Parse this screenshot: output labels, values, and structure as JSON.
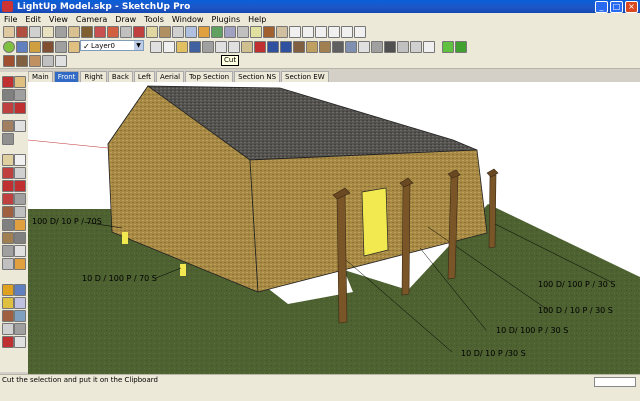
{
  "window": {
    "title": "LightUp Model.skp - SketchUp Pro",
    "minimize_glyph": "_",
    "maximize_glyph": "□",
    "close_glyph": "×"
  },
  "menu": [
    "File",
    "Edit",
    "View",
    "Camera",
    "Draw",
    "Tools",
    "Window",
    "Plugins",
    "Help"
  ],
  "toolbar": {
    "layer_select": {
      "value": "Layer0",
      "check": "✓",
      "arrow": "▼"
    },
    "tooltip": "Cut"
  },
  "scene_tabs": [
    {
      "label": "Main",
      "active": false
    },
    {
      "label": "Front",
      "active": true
    },
    {
      "label": "Right",
      "active": false
    },
    {
      "label": "Back",
      "active": false
    },
    {
      "label": "Left",
      "active": false
    },
    {
      "label": "Aerial",
      "active": false
    },
    {
      "label": "Top Section",
      "active": false
    },
    {
      "label": "Section NS",
      "active": false
    },
    {
      "label": "Section EW",
      "active": false
    }
  ],
  "viewport": {
    "dimension_labels": [
      "100 D/ 10 P / 70S",
      "10 D / 100 P / 70 S",
      "100 D/ 100 P / 30 S",
      "100 D / 10 P / 30 S",
      "10 D/ 100 P / 30 S",
      "10 D/ 10 P /30 S"
    ]
  },
  "status": {
    "text": "Cut the selection and put it on the Clipboard"
  },
  "colors": {
    "wall": "#a88a45",
    "roof": "#55534f",
    "ground": "#4d6131",
    "sky": "#ffffff",
    "post": "#7a5527",
    "door": "#f1e94f",
    "title_bar": "#1e56c6"
  }
}
